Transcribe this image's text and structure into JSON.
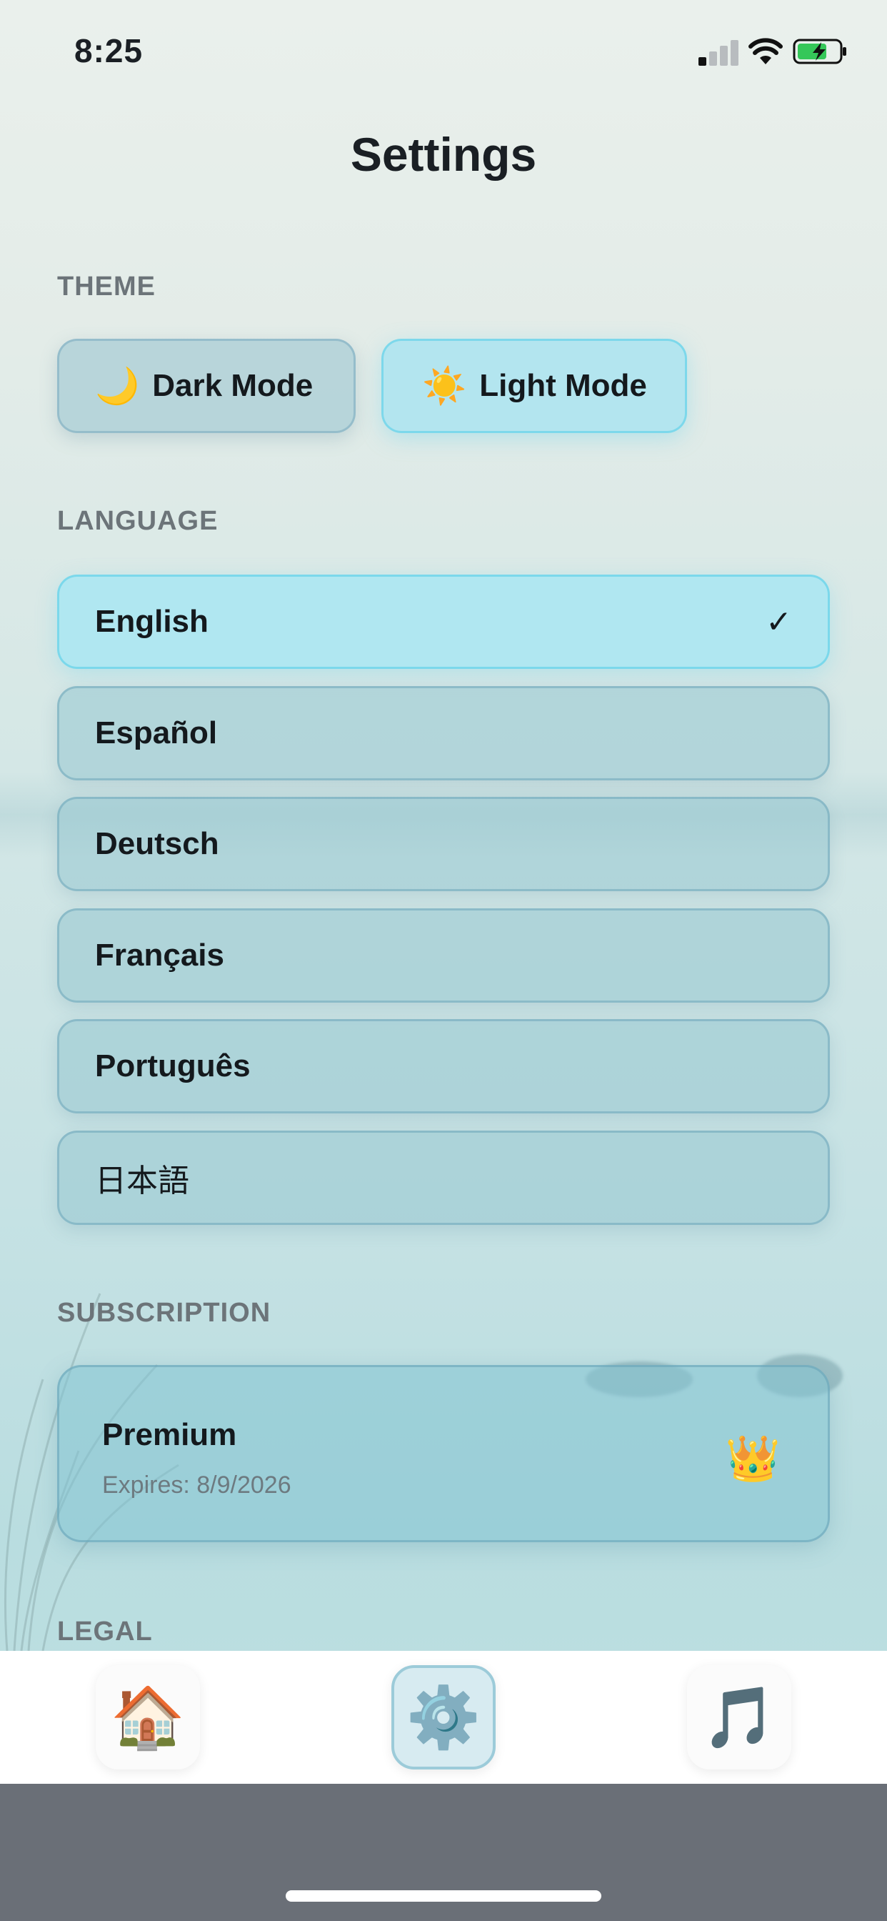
{
  "status_bar": {
    "time": "8:25"
  },
  "page_title": "Settings",
  "theme": {
    "label": "THEME",
    "options": [
      {
        "emoji": "🌙",
        "label": "Dark Mode",
        "selected": false
      },
      {
        "emoji": "☀️",
        "label": "Light Mode",
        "selected": true
      }
    ]
  },
  "language": {
    "label": "LANGUAGE",
    "items": [
      {
        "label": "English",
        "selected": true,
        "check": "✓"
      },
      {
        "label": "Español",
        "selected": false
      },
      {
        "label": "Deutsch",
        "selected": false
      },
      {
        "label": "Français",
        "selected": false
      },
      {
        "label": "Português",
        "selected": false
      },
      {
        "label": "日本語",
        "selected": false
      }
    ]
  },
  "subscription": {
    "label": "SUBSCRIPTION",
    "plan": "Premium",
    "expiry": "Expires: 8/9/2026",
    "icon": "👑"
  },
  "legal": {
    "label": "LEGAL"
  },
  "tab_bar": {
    "tabs": [
      {
        "name": "home-icon",
        "glyph": "🏠",
        "active": false
      },
      {
        "name": "gear-icon",
        "glyph": "⚙️",
        "active": true
      },
      {
        "name": "music-note-icon",
        "glyph": "🎵",
        "active": false
      }
    ]
  },
  "colors": {
    "accent": "#aae4f0",
    "tab_active": "#d7ebf1",
    "home_area": "#6a6f77"
  }
}
